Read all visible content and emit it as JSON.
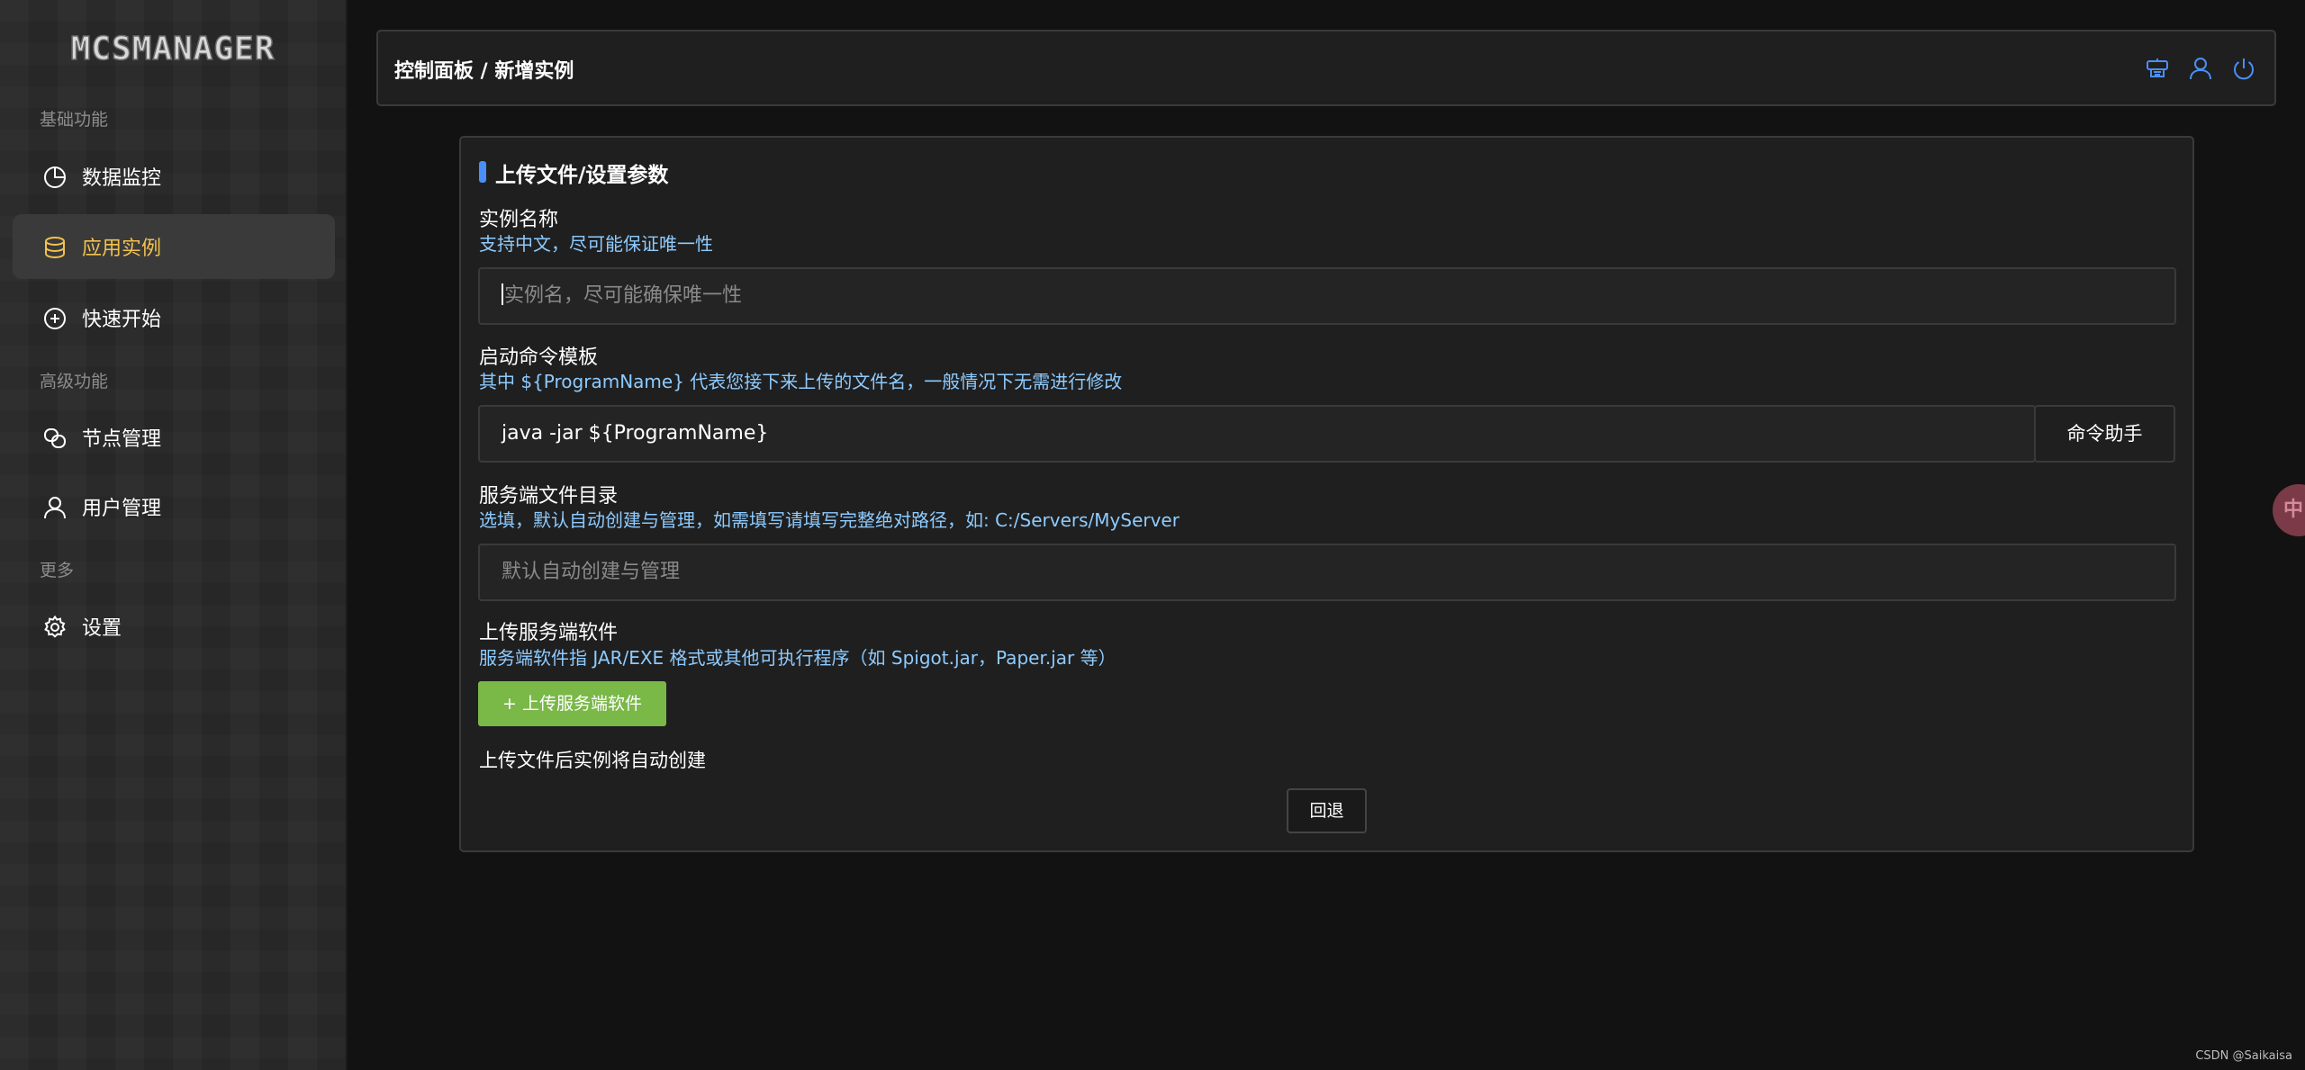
{
  "app": {
    "logo_text": "MCSMANAGER"
  },
  "sidebar": {
    "sections": [
      {
        "title": "基础功能"
      },
      {
        "title": "高级功能"
      },
      {
        "title": "更多"
      }
    ],
    "items": [
      {
        "label": "数据监控",
        "icon": "pie-chart-icon"
      },
      {
        "label": "应用实例",
        "icon": "database-icon",
        "active": true
      },
      {
        "label": "快速开始",
        "icon": "plus-circle-icon"
      },
      {
        "label": "节点管理",
        "icon": "nodes-icon"
      },
      {
        "label": "用户管理",
        "icon": "user-icon"
      },
      {
        "label": "设置",
        "icon": "gear-icon"
      }
    ]
  },
  "header": {
    "breadcrumb": "控制面板 / 新增实例",
    "icons": [
      "translate-icon",
      "user-icon",
      "power-icon"
    ]
  },
  "card": {
    "title": "上传文件/设置参数",
    "instance_name": {
      "label": "实例名称",
      "help": "支持中文，尽可能保证唯一性",
      "placeholder": "实例名，尽可能确保唯一性"
    },
    "start_command": {
      "label": "启动命令模板",
      "help": "其中 ${ProgramName} 代表您接下来上传的文件名，一般情况下无需进行修改",
      "value": "java -jar ${ProgramName}",
      "helper_button": "命令助手"
    },
    "server_dir": {
      "label": "服务端文件目录",
      "help": "选填，默认自动创建与管理，如需填写请填写完整绝对路径，如: C:/Servers/MyServer",
      "placeholder": "默认自动创建与管理"
    },
    "upload": {
      "label": "上传服务端软件",
      "help": "服务端软件指 JAR/EXE 格式或其他可执行程序（如 Spigot.jar，Paper.jar 等）",
      "button": "+ 上传服务端软件",
      "note": "上传文件后实例将自动创建"
    },
    "back_button": "回退"
  },
  "floating": {
    "lang_label": "中"
  },
  "watermark": "CSDN @Saikaisa",
  "colors": {
    "accent": "#4a8ff5",
    "active_nav": "#f2c14e",
    "help_text": "#8ecbff",
    "upload_button": "#7ab848"
  }
}
